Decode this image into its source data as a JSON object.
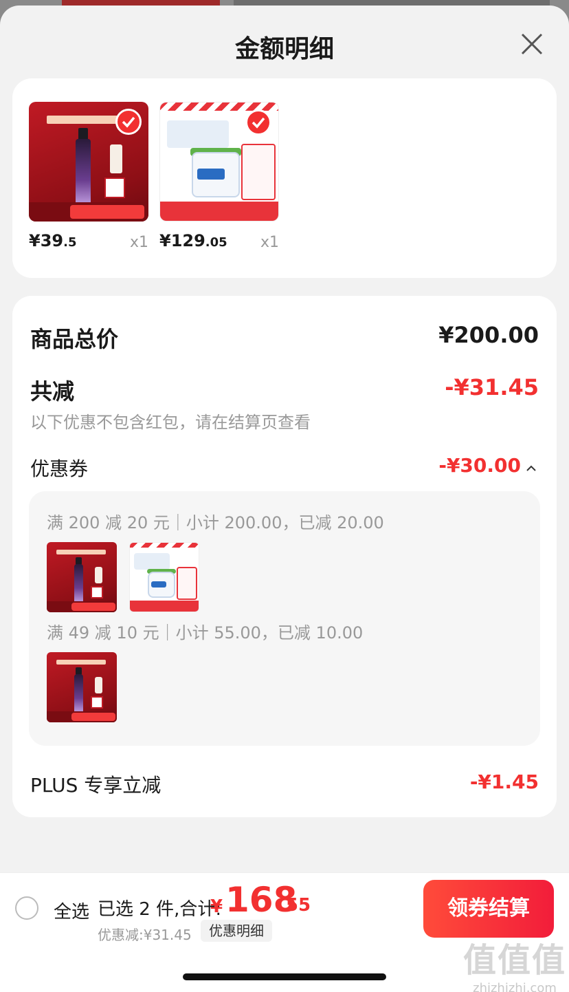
{
  "header": {
    "title": "金额明细"
  },
  "products": [
    {
      "price_int": "¥39",
      "price_dec": ".5",
      "qty": "x1"
    },
    {
      "price_int": "¥129",
      "price_dec": ".05",
      "qty": "x1"
    }
  ],
  "summary": {
    "total_label": "商品总价",
    "total_value": "¥200.00",
    "reduce_label": "共减",
    "reduce_value": "-¥31.45",
    "note": "以下优惠不包含红包，请在结算页查看",
    "coupon_label": "优惠券",
    "coupon_value": "-¥30.00"
  },
  "coupon_rules": [
    {
      "text": "满 200 减 20 元｜小计 200.00，已减 20.00"
    },
    {
      "text": "满 49 减 10 元｜小计 55.00，已减 10.00"
    }
  ],
  "plus": {
    "label": "PLUS 专享立减",
    "value": "-¥1.45"
  },
  "bottom_bar": {
    "select_all": "全选",
    "selected_text": "已选 2 件,合计:",
    "total_currency": "¥",
    "total_int": "168",
    "total_dec": ".55",
    "discount_text": "优惠减:¥31.45",
    "detail_link": "优惠明细",
    "checkout": "领券结算"
  },
  "watermark": {
    "logo": "值值值",
    "site": "zhizhizhi.com"
  },
  "colors": {
    "accent": "#f23030",
    "background": "#f2f2f2",
    "card": "#ffffff"
  },
  "icons": [
    "close-icon",
    "check-icon",
    "chevron-up-icon",
    "radio-unchecked-icon"
  ]
}
